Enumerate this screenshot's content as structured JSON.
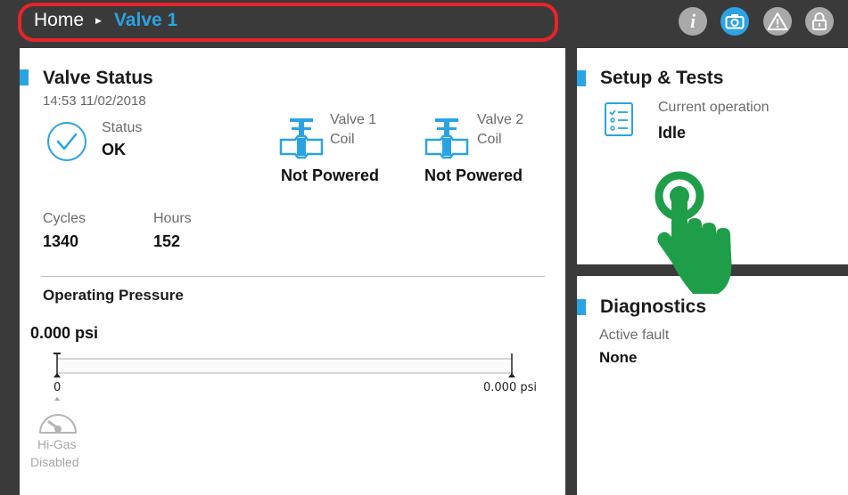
{
  "breadcrumb": {
    "home": "Home",
    "current": "Valve 1"
  },
  "toolbar": {
    "icons": [
      "info-icon",
      "camera-icon",
      "warning-icon",
      "lock-icon"
    ],
    "info_glyph": "i"
  },
  "valve_status": {
    "title": "Valve Status",
    "timestamp": "14:53 11/02/2018",
    "status_label": "Status",
    "status_value": "OK",
    "valve1_label_line1": "Valve 1",
    "valve1_label_line2": "Coil",
    "valve1_value": "Not Powered",
    "valve2_label_line1": "Valve 2",
    "valve2_label_line2": "Coil",
    "valve2_value": "Not Powered",
    "cycles_label": "Cycles",
    "cycles_value": "1340",
    "hours_label": "Hours",
    "hours_value": "152",
    "pressure_title": "Operating Pressure",
    "pressure_value": "0.000 psi",
    "scale_min": "0",
    "scale_max": "0.000 psi",
    "higas_line1": "Hi-Gas",
    "higas_line2": "Disabled"
  },
  "setup": {
    "title": "Setup & Tests",
    "op_label": "Current operation",
    "op_value": "Idle"
  },
  "diagnostics": {
    "title": "Diagnostics",
    "fault_label": "Active fault",
    "fault_value": "None"
  },
  "colors": {
    "accent": "#2aa3e2",
    "highlight_ring": "#e8232b",
    "touch_hand": "#1f9e4a",
    "bar": "#3a3a3a"
  }
}
